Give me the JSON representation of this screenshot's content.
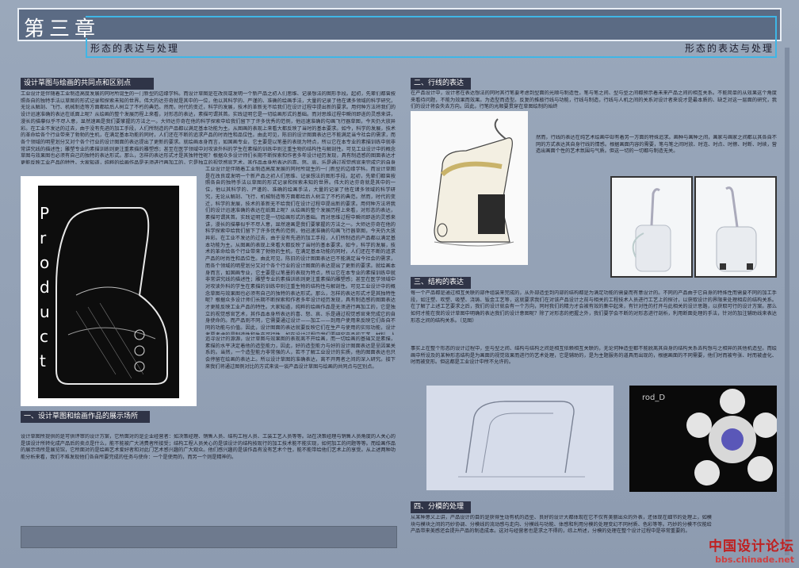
{
  "header": {
    "title": "第三章"
  },
  "subheader": {
    "left": "形态的表达与处理",
    "right": "形态的表达与处理"
  },
  "sections": {
    "s0": {
      "title": "设计草图与绘画的共同点和区别点",
      "body": "工业设计是伴随着工业制造高度发展的同时所诞生的一门新型的边缘学科。而设计草图是在改良或发明一个新产品之初人们思维、记录想法的图形手段。起初，先辈们都曾按照各自的独特手法以草图的形式记录和探索未知的世界。伟大的达芬奇就是其中的一位，他以其科学的、严谨的、准确的绘画手法，大量的记录了他在诸多领域的科学研究，无论从解剖、飞行、机械制造等方面都给后人树立了不朽的典范。然而，时代的变迁，科学的发展，技术的革新无不给我们在设计过程中提出新的要求。用何种方法将我们的设计迅速准确的表达在纸面上呢？从绘画的整个发展历程上来看，对形态的表达，素描可谓其首。实践证明它是一切绘画形式的基础。而对思维过程中瞬间即逝的灵感来讲，漫长的描摹似乎不尽人意，显然速画是我们要掌握的方法之一。大师达芬奇在他的科学探索中给我们留下了许多优秀的范例，他迅速准确的勾画飞行器草图，今天仍大放异彩。在工业不发达的过去，由于没有先进的加工手段，人们所制造的产品都以满足基本功能为主。从图画的表现上来看大都反映了当时的基本要求。如今，科学的发展，技术的革命给各个行业带来了勃勃的生机，在满足基本功能的同时，人们还在不断的追求产品的时尚性和品位性。由此可见，陈旧的设计图面表达已不能满足当今社会的需求，而各个领域的明星划分又对个各个行业的设计图面的表达提出了更新的要求。就绘画本身而言，如国画专业，它主要是以笔墨的表现为特点，所以它在本专业的素描训练中就非常讲究线的描述性；雕塑专业的素描训练则更注重素描的雕塑感；甚至在医学领域中对攻读外科的学生在素描的训练中则注重生物的结构性与解剖性。可见工业设计中的概念草图与效果图也必须有自己的独特的表达形式。那么，怎样的表达形式才是其独特性呢？根据众多设计师们长期不断探索和作者多年设计经历发现，具有制造感的图面表达才更能反映工业产品的特性。大家知道，纯粹的绘画作品是无须进行再加工的，它是独立的视觉感官艺术，其作品本身所表达的喜、怒、哀、乐是通过视觉感官来完成它的自身使命的。而产品则不同，它需要通过设计——加工——到用户使用来反映它们各自不同的功能与价值。因此，设计图面的表达就要反映它们在生产与使用的实际功能，设计者要考虑的是制造性和生产可行性，如在设计过程中我们要研究产品的工艺、材料、人机关系、起模工艺等等。",
      "body2": "追寻设计的源源，设计草图与效果图的表现离不开绘画，而一切绘画的基础又是素描，素描的水平决定着他的造型能力，因此，好的造型能力与好的设计图面表达是呈因果关系的。当然，一个造型能力非常强的人，若不了解工业设计的实质，他的图面表达也只会停留在绘画的表达上。所以设计草图的准确表达，离不开两者之间的深入研究。接下来我们将通过图例对比的方式来谈一谈产品设计草图与绘画的共同点与区别点。"
    },
    "s1": {
      "title": "一、设计草图和绘画作品的展示场所",
      "body": "设计草图所提供的是可供评审的设计方案，它所面对的是企业经营者：如决策经理、销售人员、结构工程人员、工装工艺人员等等。站在决策经理与销售人员角度的人关心的是该设计所转化成产品后的卖点是什么，能不能被广大消费者所接受；结构工程人员关心的是该设计的结构按现行的加工技术能不能实现，如何加工的问题等等。而绘画作品的展示场所是展览馆，它所面对的是绘画艺术爱好者和对此门艺术感兴趣的广大观众。他们感兴趣的是该作品有没有艺术个性，能不能带给他们艺术上的享受。从上述两种功能分析来看，我们不难发现他们各自所要完成的任务与使命：一个是使用的，而另一个则是精神的。"
    },
    "s2": {
      "title": "二、行线的表达",
      "body": "在产品设计中，设计者在表达想法的同时其行笔要考虑到型面的光顺与制造性，笔与笔之间、型与型之间都预示着未来产品之间的相互关系。不能简单的从效果这个角度来看待问题，不能为效果而效果。为造型而造型。反复的推敲行线与功能，行线与制造，行线与人机之间的关系对设计者来说才是最本质的、缺乏对这一层面的研究，我们的设计将会失去方向。因此，行笔的光顺要贯穿在草图绘制的始终",
      "body2": "然而，行线的表达在纯艺术绘画中却有着另一方面的特殊追求。画种与画种之间，画家与画家之间都以其各自不同的方式表达其自身行线的情感。根据画面内容的需要，笔与笔之间时放、时连、时点、时擦、时断、时续，营造出画面个性的艺术氛围与气质。但这一切的一切都与制造无关。"
    },
    "s3": {
      "title": "三、结构的表达",
      "body": "每一个产品都是通过相互关联的部件组装来完成的，从外部造型到内部的结构都是为满足功能的需要而有意设计的。不同的产品由于它自身的特殊性而需要不同的加工手段，如注塑、吹塑、吸塑、浇铸、钣金工艺等，这就要求我们在对该产品设计之前与相关的工程技术人员进行工艺上的探讨，以获取设计的界限来处理相应的结构关系。在了解了上述工艺要求之后，我们的设计就会有一个方向，同时我们的精力才会被有效的集中起来，有针对性的打开与此相关的设计思路，以获取可行的设计方案。那么如何才能在我的设计草图中明确的表达我们的设计意图呢？除了对形态的把握之外，我们要学会不断的对形态进行剖析，利用断面处理的手法，针对的加注辅助线来表达形态之间的结构关系。（见图）",
      "body2": "事实上在整个形态的设计过程中，型与型之间、结构与结构之间是相互依赖相互关联的，无论何种造型都不能脱离其自身的结构关系去构想与之相异的其他机造型。而绘画中所设及的某种形态结构是为画面的视觉效果而进行的艺术处理，它是辅助的，是为主题服务的道具而出现的，根据画面的不同需要，他们时而被夸张、时而被虚化、时而被变形。但这都是工业设计中所不允许的。"
    },
    "s4": {
      "title": "四、分模的处理",
      "body": "从某种意义上讲，产品设计的目的是获得生动有机的造型、良好的设计大都体现在它不仅有美丽出众的外表，还体现在细节的处理上，如模块与模块之间的巧妙协调、分模线的流动感与走向、分模线与功能、体感和利用分模的处理变幻不同材质、色彩等等。巧妙的分模不仅能给产品带来美感还会提升产品的制造成本。这对与经营者也是求之不得的，综上所述，分模的处理在整个设计过程中是非常重要的。"
    }
  },
  "product_text": "Product",
  "prod_label": "rod_D",
  "watermark": {
    "line1": "中国设计论坛",
    "line2": "bbs.chinade.net"
  },
  "colors": {
    "header": "#5b6b84",
    "accent": "#3fb6e6",
    "section_bar": "#2f3447",
    "watermark": "#c02020"
  }
}
